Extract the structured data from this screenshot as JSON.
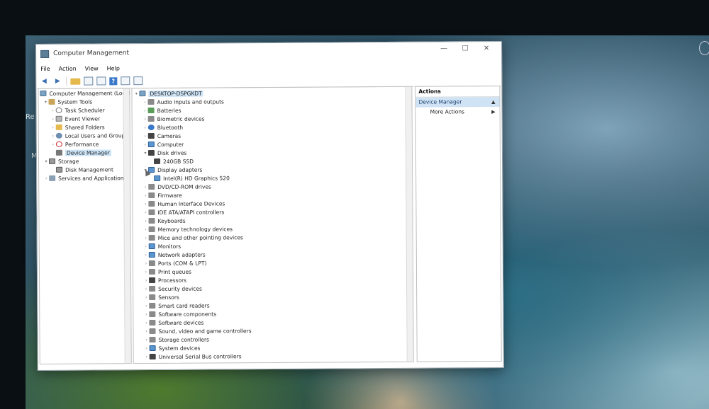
{
  "window": {
    "title": "Computer Management",
    "controls": {
      "minimize": "—",
      "maximize": "☐",
      "close": "✕"
    }
  },
  "menu": [
    "File",
    "Action",
    "View",
    "Help"
  ],
  "left_tree": {
    "root": "Computer Management (Local)",
    "system_tools": "System Tools",
    "task_scheduler": "Task Scheduler",
    "event_viewer": "Event Viewer",
    "shared_folders": "Shared Folders",
    "local_users": "Local Users and Groups",
    "performance": "Performance",
    "device_manager": "Device Manager",
    "storage": "Storage",
    "disk_management": "Disk Management",
    "services": "Services and Applications"
  },
  "device_tree": {
    "root": "DESKTOP-DSPGKDT",
    "categories": [
      "Audio inputs and outputs",
      "Batteries",
      "Biometric devices",
      "Bluetooth",
      "Cameras",
      "Computer",
      "Disk drives",
      "240GB SSD",
      "Display adapters",
      "Intel(R) HD Graphics 520",
      "DVD/CD-ROM drives",
      "Firmware",
      "Human Interface Devices",
      "IDE ATA/ATAPI controllers",
      "Keyboards",
      "Memory technology devices",
      "Mice and other pointing devices",
      "Monitors",
      "Network adapters",
      "Ports (COM & LPT)",
      "Print queues",
      "Processors",
      "Security devices",
      "Sensors",
      "Smart card readers",
      "Software components",
      "Software devices",
      "Sound, video and game controllers",
      "Storage controllers",
      "System devices",
      "Universal Serial Bus controllers"
    ]
  },
  "actions": {
    "header": "Actions",
    "section": "Device Manager",
    "more": "More Actions"
  }
}
